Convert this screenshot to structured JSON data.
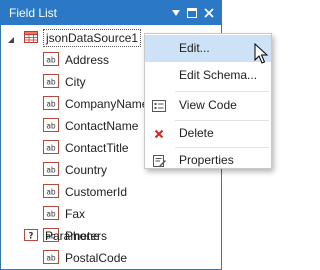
{
  "panel": {
    "title": "Field List",
    "buttons": [
      "pin-icon",
      "maximize-icon",
      "close-icon"
    ],
    "accent": "#2b78c6"
  },
  "tree": {
    "datasource": "jsonDataSource1",
    "fields": [
      "Address",
      "City",
      "CompanyName",
      "ContactName",
      "ContactTitle",
      "Country",
      "CustomerId",
      "Fax",
      "Phone",
      "PostalCode"
    ],
    "parameters": "Parameters"
  },
  "menu": {
    "items": [
      {
        "label": "Edit...",
        "icon": "none",
        "highlighted": true
      },
      {
        "label": "Edit Schema...",
        "icon": "none",
        "highlighted": false
      },
      {
        "label": "View Code",
        "icon": "code-icon",
        "highlighted": false
      },
      {
        "label": "Delete",
        "icon": "delete-icon",
        "highlighted": false
      },
      {
        "label": "Properties",
        "icon": "properties-icon",
        "highlighted": false
      }
    ]
  }
}
